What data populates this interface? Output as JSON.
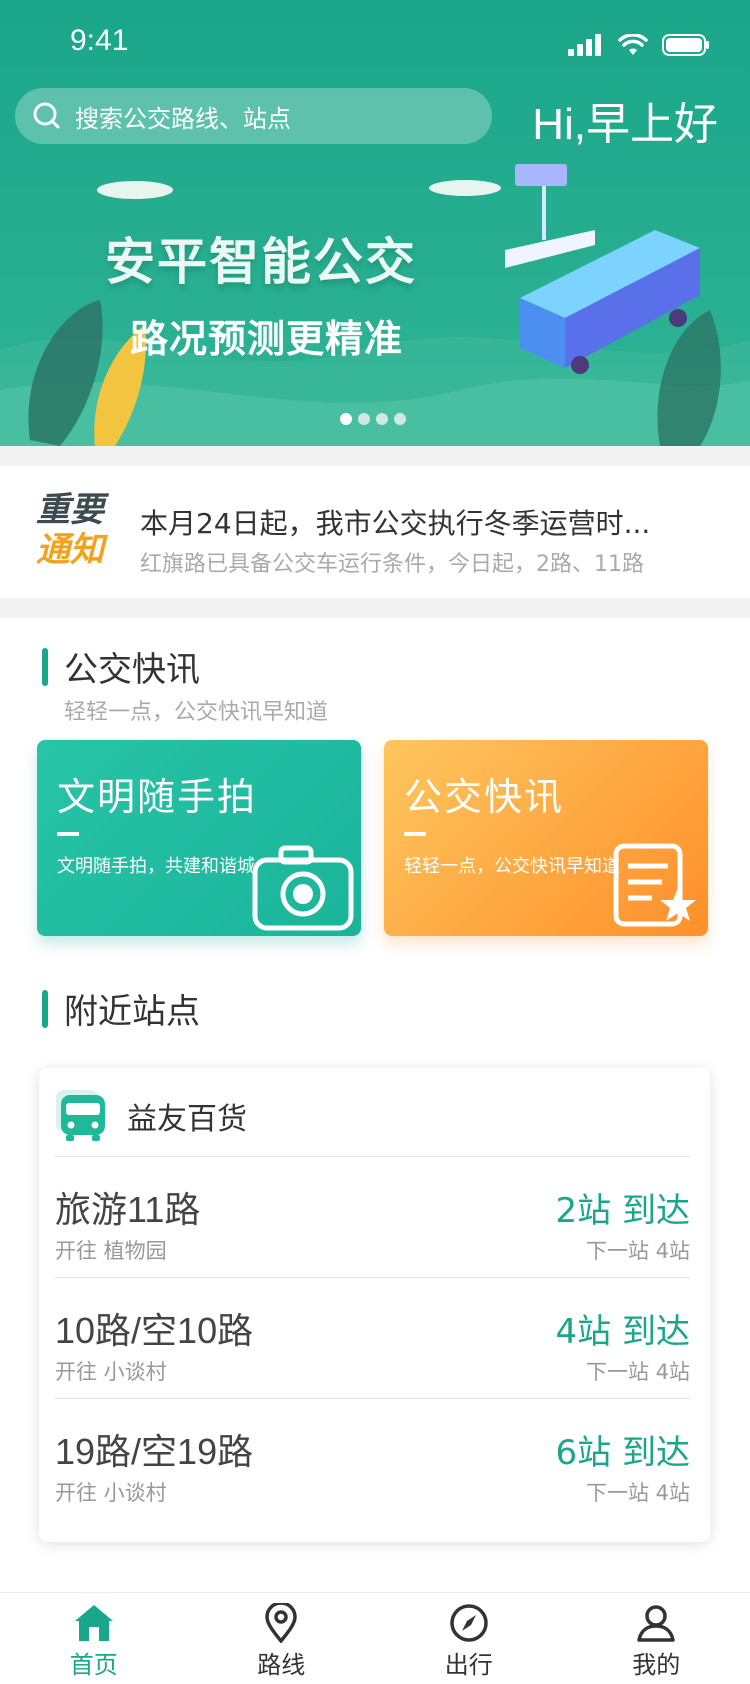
{
  "status": {
    "time": "9:41"
  },
  "header": {
    "search_placeholder": "搜索公交路线、站点",
    "greeting": "Hi,早上好"
  },
  "banner": {
    "title": "安平智能公交",
    "subtitle": "路况预测更精准",
    "page_count": 4,
    "active_page": 1
  },
  "notice": {
    "badge_line1": "重要",
    "badge_line2": "通知",
    "title": "本月24日起，我市公交执行冬季运营时...",
    "subtitle": "红旗路已具备公交车运行条件，今日起，2路、11路"
  },
  "news": {
    "title": "公交快讯",
    "desc": "轻轻一点，公交快讯早知道",
    "tiles": [
      {
        "title": "文明随手拍",
        "sub": "文明随手拍，共建和谐城",
        "icon": "camera-icon"
      },
      {
        "title": "公交快讯",
        "sub": "轻轻一点，公交快讯早知道",
        "icon": "news-star-icon"
      }
    ]
  },
  "nearby": {
    "title": "附近站点",
    "station": "益友百货",
    "routes": [
      {
        "name": "旅游11路",
        "dest": "开往 植物园",
        "eta": "2站 到达",
        "next": "下一站 4站"
      },
      {
        "name": "10路/空10路",
        "dest": "开往 小谈村",
        "eta": "4站 到达",
        "next": "下一站 4站"
      },
      {
        "name": "19路/空19路",
        "dest": "开往 小谈村",
        "eta": "6站 到达",
        "next": "下一站 4站"
      }
    ]
  },
  "tabs": [
    {
      "label": "首页",
      "icon": "home-icon",
      "active": true
    },
    {
      "label": "路线",
      "icon": "location-pin-icon",
      "active": false
    },
    {
      "label": "出行",
      "icon": "compass-icon",
      "active": false
    },
    {
      "label": "我的",
      "icon": "user-icon",
      "active": false
    }
  ],
  "colors": {
    "primary": "#1aa68a",
    "orange": "#ff8f2a",
    "notice_accent": "#f3a21d"
  }
}
